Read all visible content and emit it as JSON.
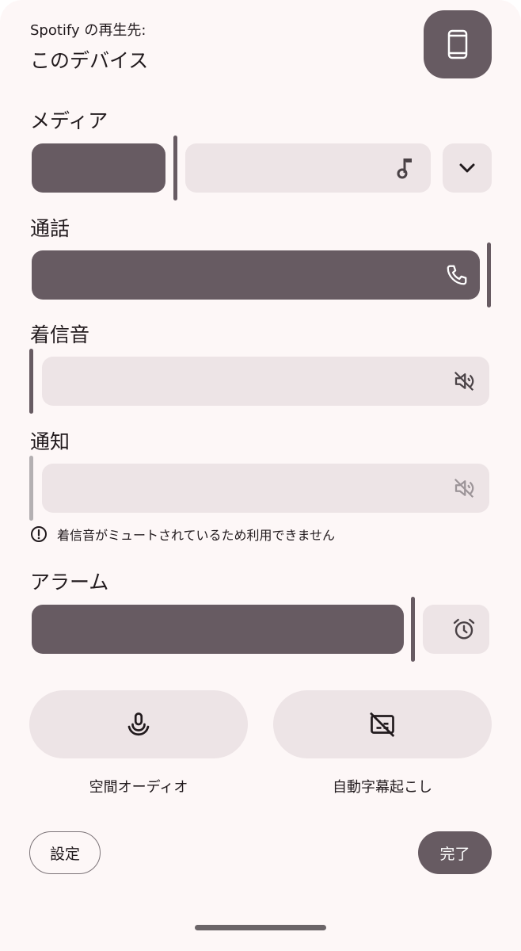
{
  "header": {
    "output_label": "Spotify の再生先:",
    "output_device": "このデバイス",
    "device_icon": "phone-icon"
  },
  "sliders": {
    "media": {
      "label": "メディア",
      "icon": "music-note-icon",
      "level": 0.29
    },
    "call": {
      "label": "通話",
      "icon": "phone-call-icon",
      "level": 1.0
    },
    "ring": {
      "label": "着信音",
      "icon": "volume-off-icon",
      "level": 0.0
    },
    "notification": {
      "label": "通知",
      "icon": "volume-off-icon",
      "level": 0.0,
      "disabled": true,
      "warning": "着信音がミュートされているため利用できません"
    },
    "alarm": {
      "label": "アラーム",
      "icon": "alarm-icon",
      "level": 0.83
    }
  },
  "toggles": {
    "spatial_audio": {
      "label": "空間オーディオ",
      "icon": "spatial-audio-icon"
    },
    "live_caption": {
      "label": "自動字幕起こし",
      "icon": "caption-off-icon"
    }
  },
  "footer": {
    "settings_label": "設定",
    "done_label": "完了"
  },
  "colors": {
    "accent": "#675b62",
    "track": "#ede4e6",
    "background": "#fdf7f7"
  }
}
